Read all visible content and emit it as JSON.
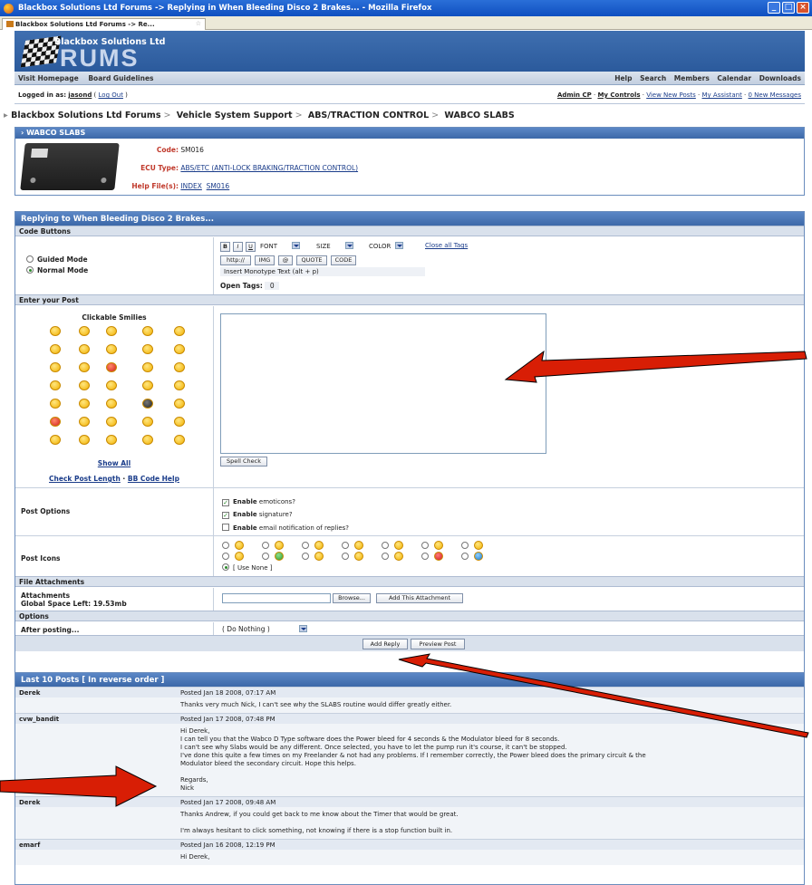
{
  "window": {
    "title": "Blackbox Solutions Ltd Forums -> Replying in When Bleeding Disco 2 Brakes... - Mozilla Firefox",
    "tab_label": "Blackbox Solutions Ltd Forums -> Re..."
  },
  "header": {
    "logo_sub": "Blackbox Solutions Ltd",
    "logo_big": "RUMS"
  },
  "navbar": {
    "left": [
      "Visit Homepage",
      "Board Guidelines"
    ],
    "right": [
      "Help",
      "Search",
      "Members",
      "Calendar",
      "Downloads"
    ]
  },
  "userbar": {
    "logged_in_prefix": "Logged in as:",
    "username": "jasond",
    "logout": "Log Out",
    "links": [
      "Admin CP",
      "My Controls",
      "View New Posts",
      "My Assistant",
      "0 New Messages"
    ]
  },
  "breadcrumb": [
    "Blackbox Solutions Ltd Forums",
    "Vehicle System Support",
    "ABS/TRACTION CONTROL",
    "WABCO SLABS"
  ],
  "infobox": {
    "title": "WABCO SLABS",
    "code_label": "Code:",
    "code_value": "SM016",
    "ecu_label": "ECU Type:",
    "ecu_value": "ABS/ETC (ANTI-LOCK BRAKING/TRACTION CONTROL)",
    "help_label": "Help File(s):",
    "help_links": [
      "INDEX",
      "SM016"
    ]
  },
  "form": {
    "title": "Replying to When Bleeding Disco 2 Brakes...",
    "code_buttons_head": "Code Buttons",
    "modes": [
      "Guided Mode",
      "Normal Mode"
    ],
    "fmt_buttons": [
      "B",
      "I",
      "U"
    ],
    "font_label": "FONT",
    "size_label": "SIZE",
    "color_label": "COLOR",
    "close_tags": "Close all Tags",
    "tag_buttons": [
      "http://",
      "IMG",
      "@",
      "QUOTE",
      "CODE"
    ],
    "monotype_hint": "Insert Monotype Text (alt + p)",
    "open_tags_label": "Open Tags:",
    "open_tags_value": "0",
    "enter_post_head": "Enter your Post",
    "smilies_title": "Clickable Smilies",
    "show_all": "Show All",
    "check_length": "Check Post Length",
    "bbcode_help": "BB Code Help",
    "spell_check": "Spell Check",
    "post_options_label": "Post Options",
    "options": [
      {
        "bold": "Enable",
        "rest": " emoticons?",
        "checked": true
      },
      {
        "bold": "Enable",
        "rest": " signature?",
        "checked": true
      },
      {
        "bold": "Enable",
        "rest": " email notification of replies?",
        "checked": false
      }
    ],
    "post_icons_label": "Post Icons",
    "use_none": "[ Use None ]",
    "file_attach_head": "File Attachments",
    "attachments_label": "Attachments",
    "space_left": "Global Space Left: 19.53mb",
    "browse": "Browse...",
    "add_attachment": "Add This Attachment",
    "options_head": "Options",
    "after_posting": "After posting...",
    "after_value": "( Do Nothing )",
    "add_reply": "Add Reply",
    "preview_post": "Preview Post"
  },
  "posts": {
    "title": "Last 10 Posts [ In reverse order ]",
    "items": [
      {
        "author": "Derek",
        "date": "Posted Jan 18 2008, 07:17 AM",
        "lines": [
          "Thanks very much Nick, I can't see why the SLABS routine would differ greatly either."
        ]
      },
      {
        "author": "cvw_bandit",
        "date": "Posted Jan 17 2008, 07:48 PM",
        "lines": [
          "Hi Derek,",
          "I can tell you that the Wabco D Type software does the Power bleed for 4 seconds & the Modulator bleed for 8 seconds.",
          "I can't see why Slabs would be any different. Once selected, you have to let the pump run it's course, it can't be stopped.",
          "I've done this quite a few times on my Freelander & not had any problems. If I remember correctly, the Power bleed does the primary circuit & the",
          "Modulator bleed the secondary circuit. Hope this helps.",
          "",
          "Regards,",
          "Nick"
        ]
      },
      {
        "author": "Derek",
        "date": "Posted Jan 17 2008, 09:48 AM",
        "lines": [
          "Thanks Andrew, if you could get back to me know about the Timer that would be great.",
          "",
          "I'm always hesitant to click something, not knowing if there is a stop function built in."
        ]
      },
      {
        "author": "emarf",
        "date": "Posted Jan 16 2008, 12:19 PM",
        "lines": [
          "Hi Derek,"
        ]
      }
    ]
  },
  "colors": {
    "accent": "#3c68a8",
    "arrow": "#d81e05",
    "label_red": "#c0392b"
  }
}
